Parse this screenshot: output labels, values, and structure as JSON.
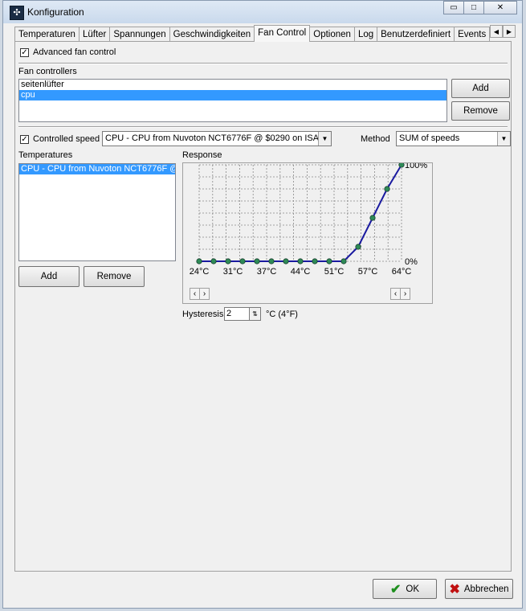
{
  "window": {
    "title": "Konfiguration",
    "minimize": "▭",
    "maximize": "□",
    "close": "✕"
  },
  "tabs": [
    "Temperaturen",
    "Lüfter",
    "Spannungen",
    "Geschwindigkeiten",
    "Fan Control",
    "Optionen",
    "Log",
    "Benutzerdefiniert",
    "Events"
  ],
  "active_tab": "Fan Control",
  "advanced": {
    "label": "Advanced fan control",
    "checked": true
  },
  "fan_controllers": {
    "label": "Fan controllers",
    "items": [
      "seitenlüfter",
      "cpu"
    ],
    "selected_index": 1,
    "add": "Add",
    "remove": "Remove"
  },
  "controlled_speed": {
    "label": "Controlled speed",
    "checked": true,
    "source": "CPU - CPU from Nuvoton NCT6776F @ $0290 on ISA",
    "method_label": "Method",
    "method": "SUM of speeds"
  },
  "temperatures": {
    "label": "Temperatures",
    "items": [
      "CPU - CPU from Nuvoton NCT6776F @"
    ],
    "selected_index": 0,
    "add": "Add",
    "remove": "Remove"
  },
  "response": {
    "label": "Response",
    "x_labels": [
      "24°C",
      "31°C",
      "37°C",
      "44°C",
      "51°C",
      "57°C",
      "64°C"
    ],
    "y_top": "100%",
    "y_bottom": "0%",
    "points": [
      0,
      0,
      0,
      0,
      0,
      0,
      0,
      0,
      0,
      0,
      0,
      15,
      45,
      75,
      100
    ],
    "line_color": "#1a1aa0",
    "point_color": "#2e8b57"
  },
  "hysteresis": {
    "label": "Hysteresis",
    "value": "2",
    "unit": "°C (4°F)"
  },
  "footer": {
    "ok": "OK",
    "cancel": "Abbrechen"
  }
}
